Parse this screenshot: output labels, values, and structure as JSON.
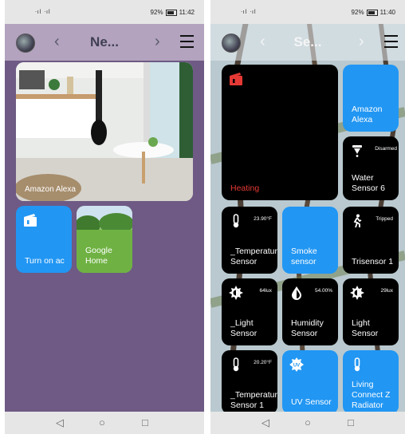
{
  "left": {
    "status": {
      "signal": "ᐧıl ᐧıl",
      "battery": "92%",
      "time": "11:42"
    },
    "title": "Ne...",
    "tiles": [
      {
        "label": "Amazon Alexa"
      },
      {
        "label": "Turn on ac"
      },
      {
        "label": "Google Home"
      }
    ]
  },
  "right": {
    "status": {
      "signal": "ᐧıl ᐧıl",
      "battery": "92%",
      "time": "11:40"
    },
    "title": "Se...",
    "tiles": [
      {
        "label": "Heating"
      },
      {
        "label": "Amazon Alexa"
      },
      {
        "label": "Water Sensor 6",
        "reading": "Disarmed"
      },
      {
        "label": "_Temperature Sensor",
        "reading": "23.90°F"
      },
      {
        "label": "Smoke sensor"
      },
      {
        "label": "Trisensor 1",
        "reading": "Tripped"
      },
      {
        "label": "_Light Sensor",
        "reading": "64lux"
      },
      {
        "label": "Humidity Sensor",
        "reading": "54.00%"
      },
      {
        "label": "Light Sensor",
        "reading": "29lux"
      },
      {
        "label": "_Temperature Sensor 1",
        "reading": "20.20°F"
      },
      {
        "label": "UV Sensor"
      },
      {
        "label": "Living Connect Z Radiator"
      }
    ]
  },
  "colors": {
    "accent_blue": "#2196f3",
    "heating_red": "#e53935",
    "left_bg": "#6e5a84"
  }
}
